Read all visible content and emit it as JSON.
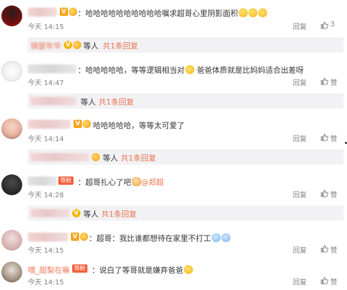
{
  "comments": [
    {
      "badges": [
        "V",
        "fan"
      ],
      "text": "：哈哈哈哈哈哈哈哈哈哈嘱求超哥心里阴影面积",
      "emoji_suffix": [
        "laugh-emoji",
        "laugh-emoji",
        "laugh-emoji"
      ],
      "time": "今天 14:15",
      "reply_label": "回复",
      "like_count": "3",
      "reply_summary": {
        "author": "锦瑟年华",
        "suffix": "等人",
        "link": "共1条回复"
      }
    },
    {
      "text_pre": "：哈哈哈哈哈，等等逻辑相当对",
      "text_post": "爸爸体质就是比妈妈适合出差呀",
      "time": "今天 14:47",
      "reply_label": "回复",
      "like_count": "赞",
      "reply_summary": {
        "suffix": "等人",
        "link": "共1条回复"
      }
    },
    {
      "text": "哈哈哈哈哈，等等太可爱了",
      "time": "今天 14:14",
      "reply_label": "回复",
      "like_count": "赞",
      "reply_summary": {
        "suffix": "等人",
        "link": "共1条回复"
      }
    },
    {
      "fan_label": "铁粉",
      "text": "：超哥扎心了吧",
      "mention": "@郑超",
      "time": "今天 14:28",
      "reply_label": "回复",
      "like_count": "赞",
      "reply_summary": {
        "suffix": "等人",
        "link": "共1条回复"
      }
    },
    {
      "text": "：超哥：我比谁都想待在家里不打工",
      "time": "今天 14:15",
      "reply_label": "回复",
      "like_count": "赞"
    },
    {
      "author": "喂_甜梨在嘛",
      "fan_label": "铁粉",
      "text": "：说白了等哥就是嫌弃爸爸",
      "time": "今天 14:15",
      "reply_label": "回复",
      "like_count": "赞"
    }
  ]
}
